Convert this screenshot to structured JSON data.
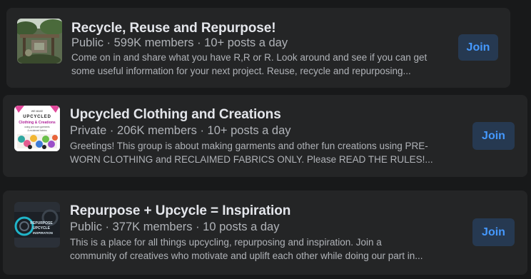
{
  "groups": [
    {
      "title": "Recycle, Reuse and Repurpose!",
      "meta": "Public · 599K members · 10+ posts a day",
      "description_line1": "Come on in and share what you have R,R or R. Look around and see if you can get",
      "description_line2": "some useful information for your next project. Reuse, recycle and repurposing...",
      "join_label": "Join",
      "thumbnail": "garden-scene-photo"
    },
    {
      "title": "Upcycled Clothing and Creations",
      "meta": "Private · 206K members · 10+ posts a day",
      "description_line1": "Greetings! This group is about making garments and other fun creations using PRE-",
      "description_line2": "WORN CLOTHING and RECLAIMED FABRICS ONLY. Please READ THE RULES!...",
      "join_label": "Join",
      "thumbnail": "upcycled-clothing-logo",
      "thumb_text": {
        "top": "WE MAKE",
        "line1": "UPCYCLED",
        "line2": "Clothing & Creations",
        "line3": "using pre-worn garments",
        "line4": "& reclaimed fabrics"
      }
    },
    {
      "title": "Repurpose + Upcycle = Inspiration",
      "meta": "Public · 377K members · 10 posts a day",
      "description_line1": "This is a place for all things upcycling, repurposing and inspiration. Join a",
      "description_line2": "community of creatives who motivate and uplift each other while doing our part in...",
      "join_label": "Join",
      "thumbnail": "repurpose-upcycle-logo",
      "thumb_text": {
        "line1": "REPURPOSE",
        "line2": "UPCYCLE",
        "line3": "INSPIRATION"
      }
    }
  ],
  "colors": {
    "page_bg": "#18191a",
    "card_bg": "#242526",
    "title": "#e4e6eb",
    "secondary": "#b0b3b8",
    "join_bg": "#263951",
    "join_text": "#4599ff"
  }
}
